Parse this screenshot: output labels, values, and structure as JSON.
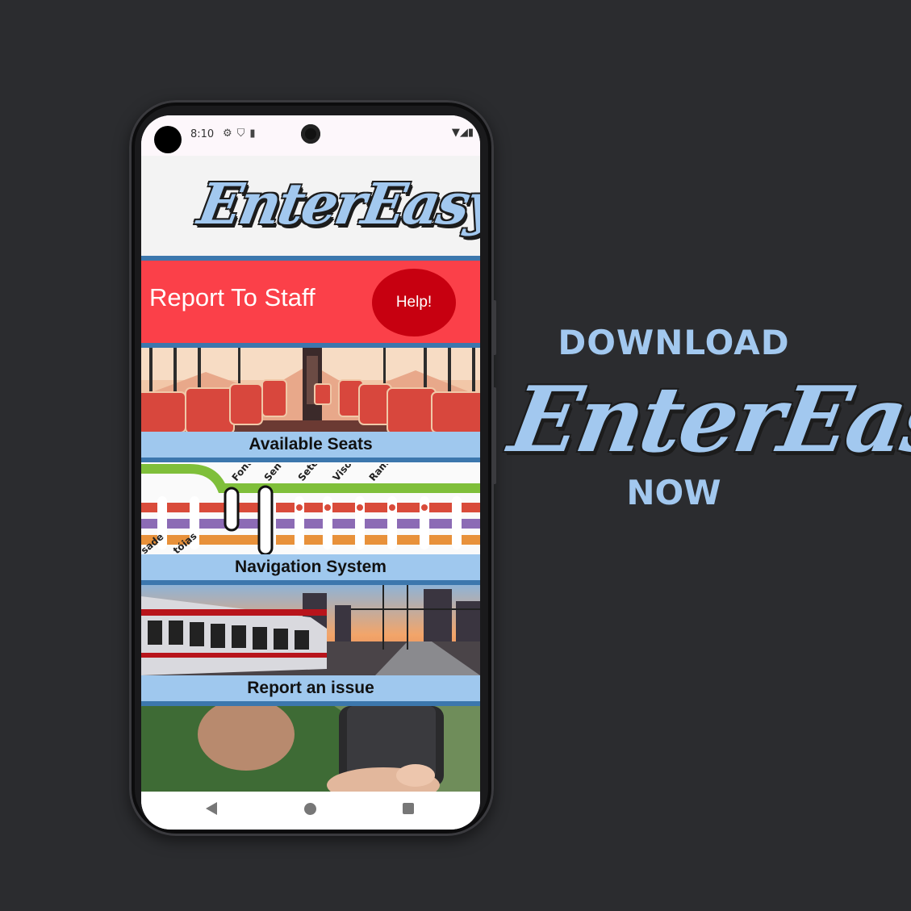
{
  "status_bar": {
    "time": "8:10",
    "left_icons": [
      "gear-icon",
      "shield-icon",
      "sim-icon"
    ],
    "right_icons": [
      "wifi-icon",
      "signal-icon",
      "battery-icon"
    ]
  },
  "app": {
    "logo_text": "EnterEasy",
    "report_banner": {
      "label": "Report To Staff",
      "help_button": "Help!"
    },
    "cards": [
      {
        "label": "Available Seats"
      },
      {
        "label": "Navigation System"
      },
      {
        "label": "Report an issue"
      }
    ],
    "map_stations": [
      "Font",
      "Sen",
      "Sete",
      "Viso",
      "Ram",
      "sade",
      "tóias"
    ]
  },
  "promo": {
    "top": "DOWNLOAD",
    "logo": "EnterEasy",
    "bottom": "NOW",
    "accent": "#a2c8ef"
  },
  "colors": {
    "background": "#2b2c2f",
    "banner_red": "#fb4049",
    "help_red": "#c70010",
    "label_blue": "#9fc8ee",
    "divider_blue": "#3c77ad"
  }
}
